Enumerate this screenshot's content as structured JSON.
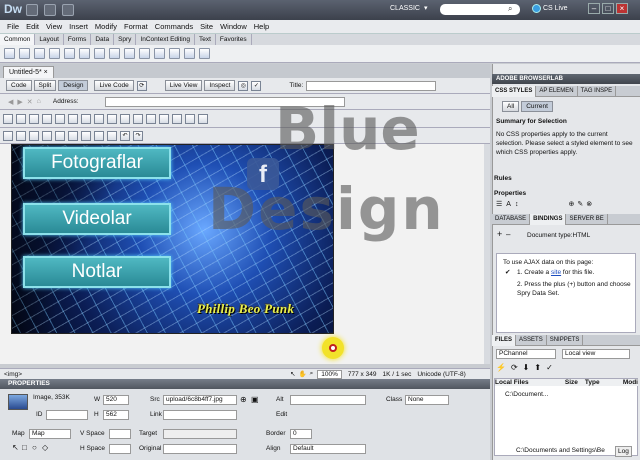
{
  "app": {
    "logo": "Dw",
    "workspace": "CLASSIC",
    "cs_live": "CS Live"
  },
  "menu": [
    "File",
    "Edit",
    "View",
    "Insert",
    "Modify",
    "Format",
    "Commands",
    "Site",
    "Window",
    "Help"
  ],
  "insert_tabs": [
    "Common",
    "Layout",
    "Forms",
    "Data",
    "Spry",
    "InContext Editing",
    "Text",
    "Favorites"
  ],
  "document": {
    "tab": "Untitled-5*",
    "view_buttons": {
      "code": "Code",
      "split": "Split",
      "design": "Design",
      "live_code": "Live Code",
      "live_view": "Live View",
      "inspect": "Inspect"
    },
    "title_label": "Title:",
    "address_label": "Address:",
    "nav_buttons": [
      "Fotograflar",
      "Videolar",
      "Notlar"
    ],
    "signature": "Phillip Beo Punk",
    "facebook_letter": "f"
  },
  "watermark": {
    "line1": "Blue",
    "line2": "Design"
  },
  "statusbar": {
    "tag": "<img>",
    "zoom": "100%",
    "size": "777 x 349",
    "download": "1K / 1 sec",
    "encoding": "Unicode (UTF-8)"
  },
  "properties": {
    "title": "PROPERTIES",
    "kind": "Image, 353K",
    "id_label": "ID",
    "w_label": "W",
    "w_value": "520",
    "h_label": "H",
    "h_value": "562",
    "src_label": "Src",
    "src_value": "upload/6c8b4ff7.jpg",
    "alt_label": "Alt",
    "link_label": "Link",
    "class_label": "Class",
    "class_value": "None",
    "edit_label": "Edit",
    "map_label": "Map",
    "map_value": "Map",
    "vspace_label": "V Space",
    "target_label": "Target",
    "border_label": "Border",
    "border_value": "0",
    "hspace_label": "H Space",
    "original_label": "Original",
    "align_label": "Align",
    "align_value": "Default"
  },
  "panels": {
    "browserlab": "ADOBE BROWSERLAB",
    "css_tabs": [
      "CSS STYLES",
      "AP ELEMEN",
      "TAG INSPE"
    ],
    "css_modes": [
      "All",
      "Current"
    ],
    "summary_title": "Summary for Selection",
    "summary_text": "No CSS properties apply to the current selection.  Please select a styled element to see which CSS properties apply.",
    "rules": "Rules",
    "properties": "Properties",
    "db_tabs": [
      "DATABASE",
      "BINDINGS",
      "SERVER BE"
    ],
    "doc_type": "Document type:HTML",
    "bind_intro": "To use AJAX data on this page:",
    "bind_step1_pre": "1.  Create a ",
    "bind_step1_link": "site",
    "bind_step1_post": " for this file.",
    "bind_step2": "2.  Press the plus (+) button and choose Spry Data Set.",
    "files_tabs": [
      "FILES",
      "ASSETS",
      "SNIPPETS"
    ],
    "site_select": "PChannel",
    "view_select": "Local view",
    "file_cols": [
      "Local Files",
      "Size",
      "Type",
      "Modi"
    ],
    "file_row": "C:\\Document...",
    "bottom_path": "C:\\Documents and Settings\\Be",
    "log": "Log"
  }
}
